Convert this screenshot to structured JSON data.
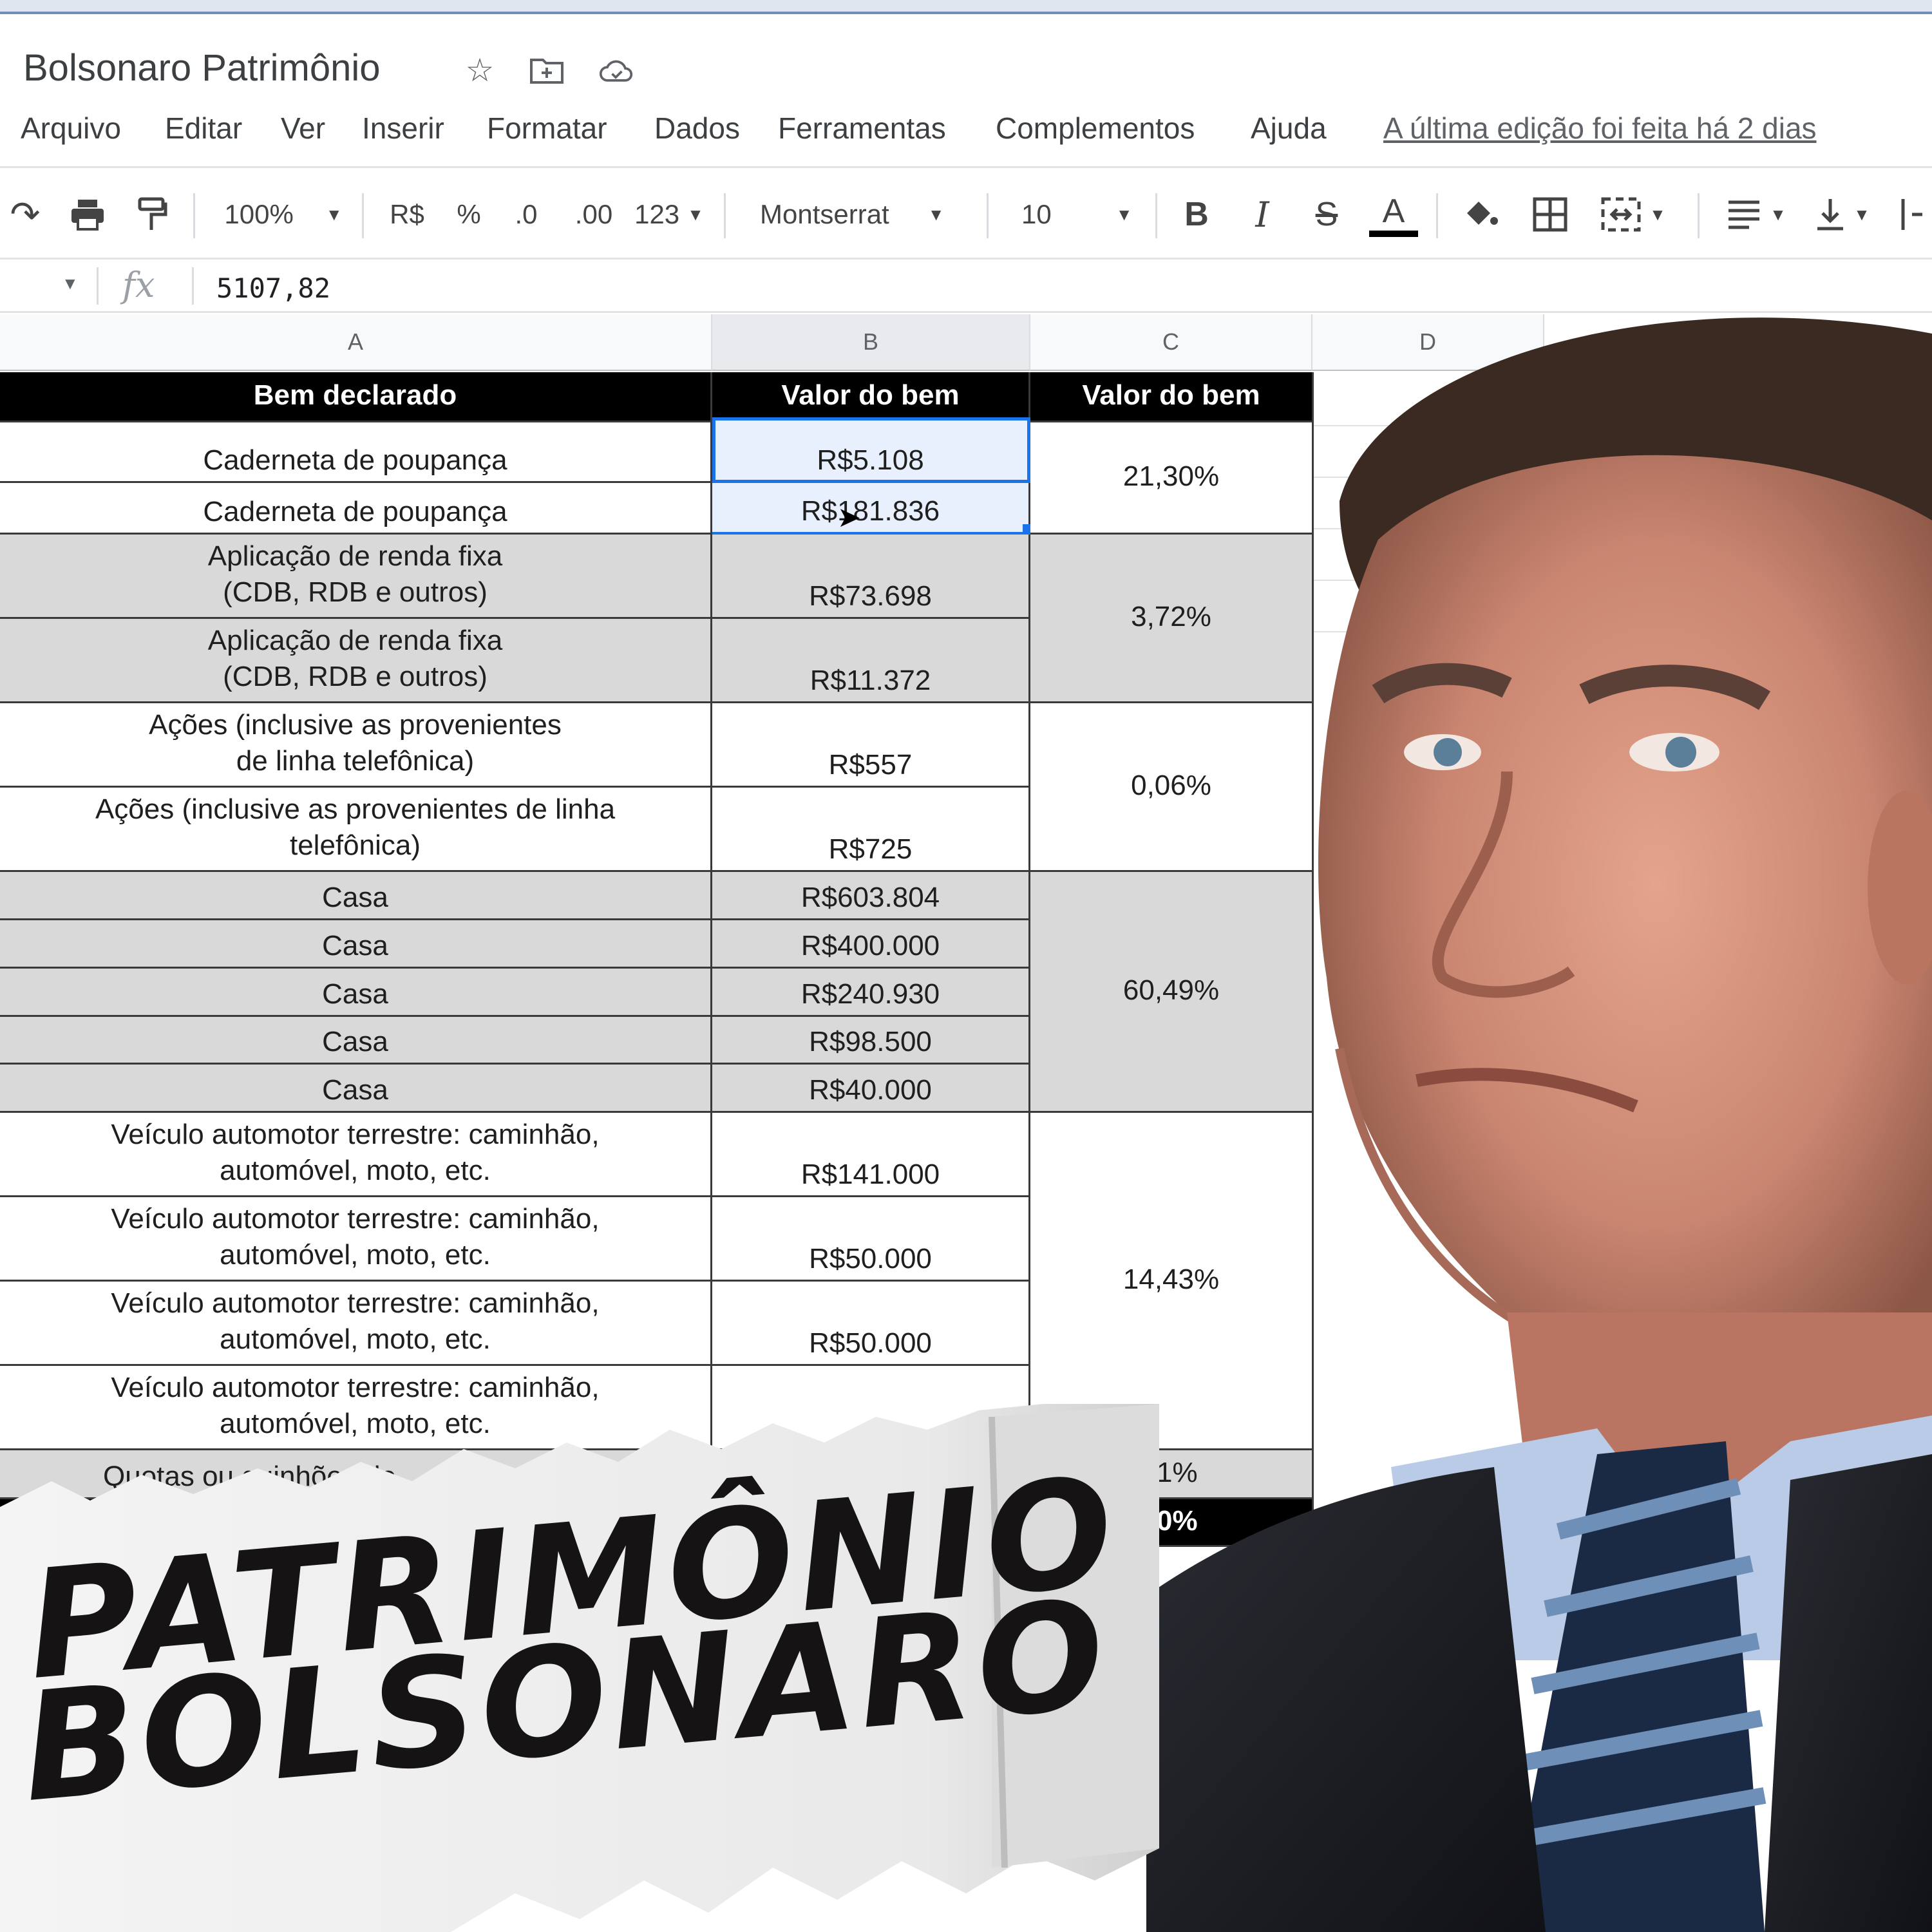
{
  "document": {
    "title": "Bolsonaro Patrimônio",
    "title_icons": [
      "star-icon",
      "move-to-folder-icon",
      "cloud-status-icon"
    ]
  },
  "menu": {
    "items": [
      "Arquivo",
      "Editar",
      "Ver",
      "Inserir",
      "Formatar",
      "Dados",
      "Ferramentas",
      "Complementos",
      "Ajuda"
    ],
    "last_edit": "A última edição foi feita há 2 dias"
  },
  "toolbar": {
    "zoom": "100%",
    "currency": "R$",
    "percent": "%",
    "decrease_decimals": ".0",
    "increase_decimals": ".00",
    "more_formats": "123",
    "font": "Montserrat",
    "font_size": "10",
    "bold": "B",
    "italic": "I",
    "strikethrough": "S",
    "text_color": "A"
  },
  "formula_bar": {
    "fx": "fx",
    "value": "5107,82"
  },
  "columns": [
    "A",
    "B",
    "C",
    "D"
  ],
  "table": {
    "headers": [
      "Bem declarado",
      "Valor do bem",
      "Valor do bem"
    ],
    "rows": [
      {
        "bem": "Caderneta de poupança",
        "valor": "R$5.108"
      },
      {
        "bem": "Caderneta de poupança",
        "valor": "R$181.836"
      },
      {
        "bem": "Aplicação de renda fixa\n(CDB, RDB e outros)",
        "valor": "R$73.698"
      },
      {
        "bem": "Aplicação de renda fixa\n(CDB, RDB e outros)",
        "valor": "R$11.372"
      },
      {
        "bem": "Ações (inclusive as provenientes\nde linha telefônica)",
        "valor": "R$557"
      },
      {
        "bem": "Ações (inclusive as provenientes de linha\ntelefônica)",
        "valor": "R$725"
      },
      {
        "bem": "Casa",
        "valor": "R$603.804"
      },
      {
        "bem": "Casa",
        "valor": "R$400.000"
      },
      {
        "bem": "Casa",
        "valor": "R$240.930"
      },
      {
        "bem": "Casa",
        "valor": "R$98.500"
      },
      {
        "bem": "Casa",
        "valor": "R$40.000"
      },
      {
        "bem": "Veículo automotor terrestre: caminhão,\nautomóvel, moto, etc.",
        "valor": "R$141.000"
      },
      {
        "bem": "Veículo automotor terrestre: caminhão,\nautomóvel, moto, etc.",
        "valor": "R$50.000"
      },
      {
        "bem": "Veículo automotor terrestre: caminhão,\nautomóvel, moto, etc.",
        "valor": "R$50.000"
      },
      {
        "bem": "Veículo automotor terrestre: caminhão,\nautomóvel, moto, etc.",
        "valor": ""
      },
      {
        "bem": "Quotas ou quinhões de",
        "valor": ""
      }
    ],
    "percentages": [
      "21,30%",
      "3,72%",
      "0,06%",
      "60,49%",
      "14,43%",
      "1%",
      "0%"
    ]
  },
  "banner": {
    "line1": "PATRIMÔNIO",
    "line2": "BOLSONARO"
  },
  "colors": {
    "header_bg": "#000000",
    "gray_row": "#d9d9d9",
    "selection": "#1a73e8"
  }
}
